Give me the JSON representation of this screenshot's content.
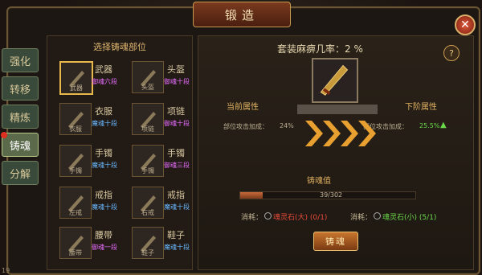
{
  "window": {
    "title": "锻造",
    "close_label": "✕"
  },
  "tabs": [
    "强化",
    "转移",
    "精炼",
    "铸魂",
    "分解"
  ],
  "active_tab": 3,
  "left_panel": {
    "header": "选择铸魂部位",
    "slots": [
      {
        "name": "武器",
        "caption": "武器",
        "level": "御魂六段",
        "level_color": "#e86cff",
        "selected": true
      },
      {
        "name": "头盔",
        "caption": "头盔",
        "level": "御魂十段",
        "level_color": "#e86cff"
      },
      {
        "name": "衣服",
        "caption": "衣服",
        "level": "魔魂十段",
        "level_color": "#6ab8ff"
      },
      {
        "name": "项链",
        "caption": "项链",
        "level": "御魂十段",
        "level_color": "#e86cff"
      },
      {
        "name": "手镯",
        "caption": "手镯",
        "level": "魔魂十段",
        "level_color": "#6ab8ff"
      },
      {
        "name": "手镯",
        "caption": "手镯",
        "level": "御魂三段",
        "level_color": "#e86cff"
      },
      {
        "name": "戒指",
        "caption": "左戒",
        "level": "魔魂十段",
        "level_color": "#6ab8ff"
      },
      {
        "name": "戒指",
        "caption": "右戒",
        "level": "魔魂十段",
        "level_color": "#6ab8ff"
      },
      {
        "name": "腰带",
        "caption": "腰带",
        "level": "御魂一段",
        "level_color": "#e86cff"
      },
      {
        "name": "鞋子",
        "caption": "鞋子",
        "level": "魔魂十段",
        "level_color": "#6ab8ff"
      }
    ]
  },
  "right_panel": {
    "set_rate": "套装麻痹几率：2 %",
    "help": "?",
    "current_label": "当前属性",
    "next_label": "下阶属性",
    "current_stat": "部位攻击加成：",
    "current_value": "24%",
    "next_stat": "部位攻击加成：",
    "next_value": "25.5%",
    "temper_label": "铸魂值",
    "progress_text": "39/302",
    "progress_fraction": 0.13,
    "consume_label": "消耗：",
    "stone_big": "魂灵石(大)",
    "stone_big_count": "(0/1)",
    "stone_small": "魂灵石(小)",
    "stone_small_count": "(5/1)",
    "action_button": "铸魂"
  },
  "corner_text": "19"
}
